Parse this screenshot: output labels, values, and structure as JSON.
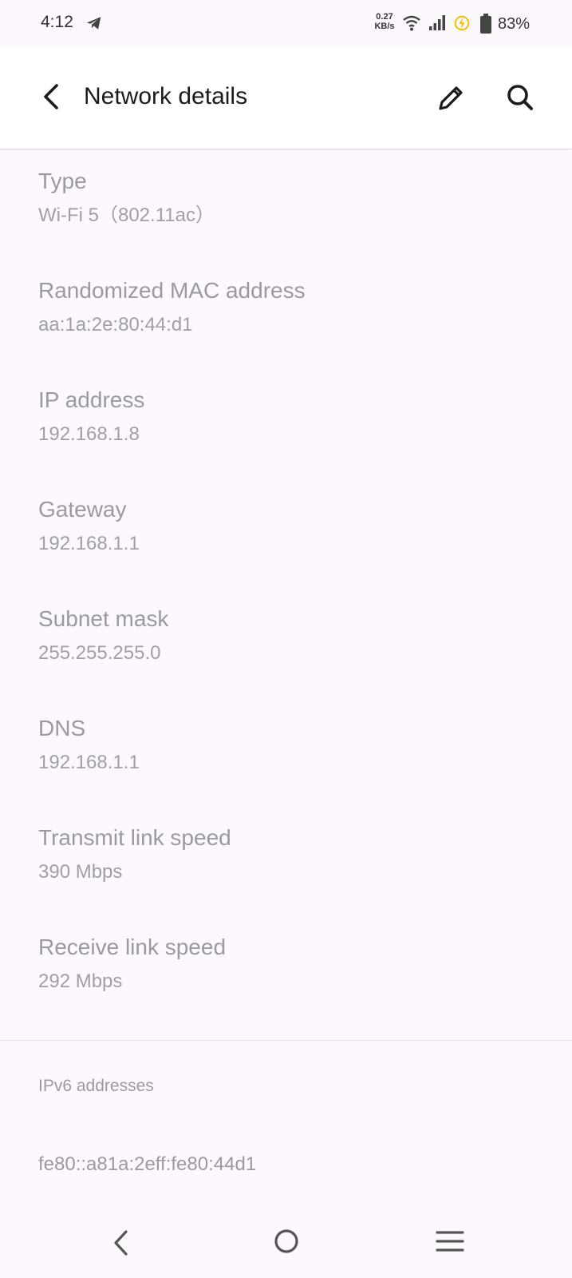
{
  "status_bar": {
    "time": "4:12",
    "speed_value": "0.27",
    "speed_unit": "KB/s",
    "battery": "83%",
    "icons": [
      "telegram-icon",
      "wifi-icon",
      "signal-icon",
      "power-save-icon",
      "battery-icon"
    ],
    "power_icon_color": "#f2c200"
  },
  "app_bar": {
    "title": "Network details",
    "back_icon": "arrow-back-icon",
    "edit_icon": "pencil-icon",
    "search_icon": "search-icon"
  },
  "details": [
    {
      "label": "Type",
      "value": "Wi-Fi 5（802.11ac）"
    },
    {
      "label": "Randomized MAC address",
      "value": "aa:1a:2e:80:44:d1"
    },
    {
      "label": "IP address",
      "value": "192.168.1.8"
    },
    {
      "label": "Gateway",
      "value": "192.168.1.1"
    },
    {
      "label": "Subnet mask",
      "value": "255.255.255.0"
    },
    {
      "label": "DNS",
      "value": "192.168.1.1"
    },
    {
      "label": "Transmit link speed",
      "value": "390 Mbps"
    },
    {
      "label": "Receive link speed",
      "value": "292 Mbps"
    }
  ],
  "ipv6": {
    "header": "IPv6 addresses",
    "address": "fe80::a81a:2eff:fe80:44d1"
  },
  "nav_bar": {
    "icons": [
      "nav-back-icon",
      "nav-home-icon",
      "nav-recents-icon"
    ]
  }
}
